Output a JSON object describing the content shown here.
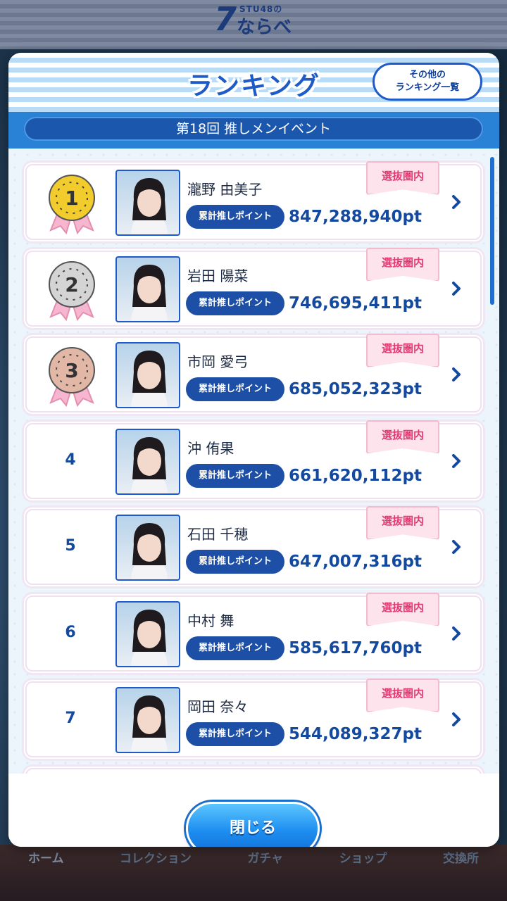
{
  "app": {
    "logo_small": "STU48の",
    "logo_num": "7",
    "logo_big": "ならべ"
  },
  "modal": {
    "title": "ランキング",
    "other_ranking_line1": "その他の",
    "other_ranking_line2": "ランキング一覧",
    "event_name": "第18回 推しメンイベント",
    "points_label": "累計推しポイント",
    "badge_label": "選抜圏内",
    "close_label": "閉じる"
  },
  "rankings": [
    {
      "rank": "1",
      "name": "瀧野 由美子",
      "points": "847,288,940pt",
      "medal": "gold"
    },
    {
      "rank": "2",
      "name": "岩田 陽菜",
      "points": "746,695,411pt",
      "medal": "silver"
    },
    {
      "rank": "3",
      "name": "市岡 愛弓",
      "points": "685,052,323pt",
      "medal": "bronze"
    },
    {
      "rank": "4",
      "name": "沖 侑果",
      "points": "661,620,112pt",
      "medal": ""
    },
    {
      "rank": "5",
      "name": "石田 千穂",
      "points": "647,007,316pt",
      "medal": ""
    },
    {
      "rank": "6",
      "name": "中村 舞",
      "points": "585,617,760pt",
      "medal": ""
    },
    {
      "rank": "7",
      "name": "岡田 奈々",
      "points": "544,089,327pt",
      "medal": ""
    }
  ],
  "bottom_nav": [
    "ホーム",
    "コレクション",
    "ガチャ",
    "ショップ",
    "交換所"
  ],
  "colors": {
    "accent": "#1e5ac8",
    "gold": "#f2cc2c",
    "silver": "#d4d4d4",
    "bronze": "#e2b7a6",
    "ribbon": "#f6b6cf"
  }
}
